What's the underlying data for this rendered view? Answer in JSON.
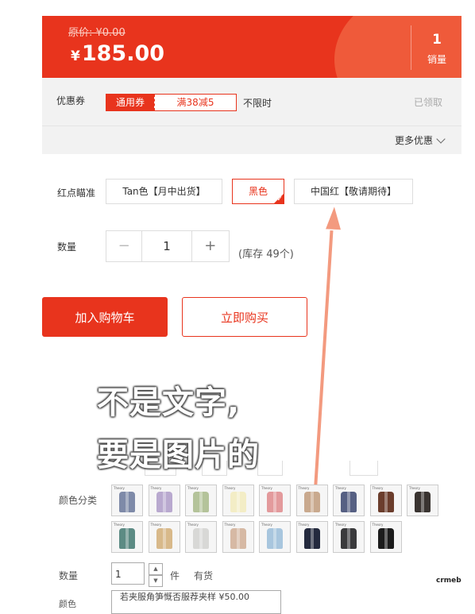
{
  "price_bar": {
    "original_price_label": "原价: ¥0.00",
    "currency": "¥",
    "price": "185.00",
    "sales_count": "1",
    "sales_label": "销量"
  },
  "coupon": {
    "label": "优惠券",
    "tag_type": "通用券",
    "tag_rule": "满38减5",
    "limit_text": "不限时",
    "claimed_text": "已领取",
    "more_text": "更多优惠"
  },
  "spec": {
    "label": "红点瞄准",
    "options": [
      {
        "label": "Tan色【月中出货】",
        "selected": false
      },
      {
        "label": "黑色",
        "selected": true
      },
      {
        "label": "中国红【敬请期待】",
        "selected": false
      }
    ]
  },
  "quantity": {
    "label": "数量",
    "minus": "−",
    "value": "1",
    "plus": "+",
    "stock_text": "(库存 49个)"
  },
  "actions": {
    "add_to_cart": "加入购物车",
    "buy_now": "立即购买"
  },
  "annotation": {
    "line1": "不是文字,",
    "line2": "要是图片的",
    "arrow_color": "#f39a7f"
  },
  "color_section": {
    "label": "颜色分类",
    "swatch_brand": "Theory",
    "swatches_row1": [
      "#7e8aa8",
      "#b9a9cf",
      "#b4c39a",
      "#f3edc6",
      "#e39a9c",
      "#c9a98e",
      "#566083",
      "#6b3d2c",
      "#3a3431"
    ],
    "swatches_row2": [
      "#5c8b84",
      "#d8b98a",
      "#d8d8d6",
      "#d6b9a4",
      "#a8c6de",
      "#242a3e",
      "#3a3a3c",
      "#1c1c1c"
    ]
  },
  "lower_qty": {
    "label": "数量",
    "value": "1",
    "unit": "件",
    "stock": "有货",
    "partial_label": "颜色",
    "partial_value": "若夹服角笋慨否服荐夹样 ¥50.00"
  },
  "watermark": "crmeb",
  "colors": {
    "accent": "#e8341d",
    "banner_light": "#ef5a3a"
  }
}
